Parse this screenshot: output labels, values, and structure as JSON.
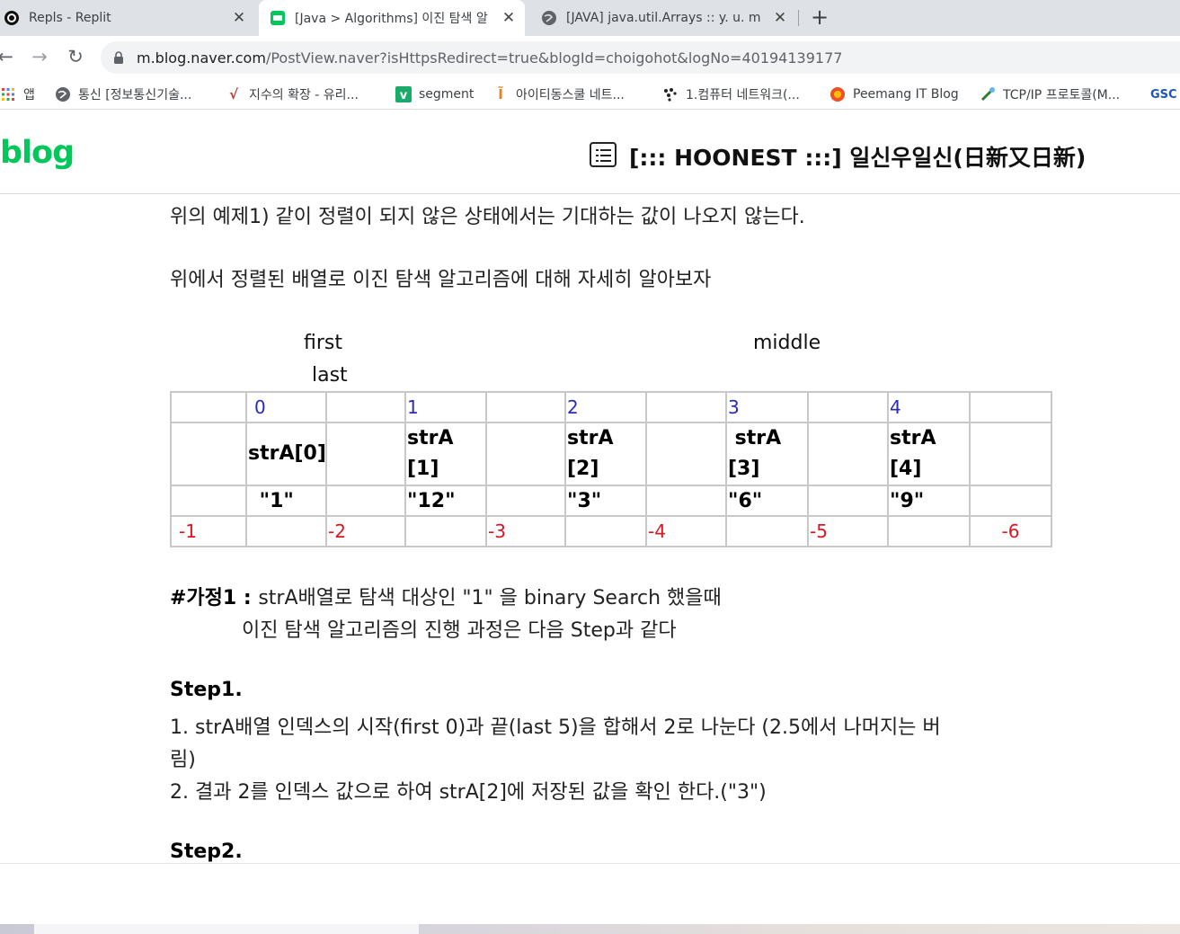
{
  "browser": {
    "tabs": [
      {
        "title": "Repls - Replit",
        "icon": "replit-icon"
      },
      {
        "title": "[Java > Algorithms] 이진 탐색 알",
        "icon": "naver-blog-icon"
      },
      {
        "title": "[JAVA] java.util.Arrays :: y. u. m",
        "icon": "globe-icon"
      }
    ],
    "new_tab": "+",
    "close_glyph": "✕",
    "url_host": "m.blog.naver.com",
    "url_path": "/PostView.naver?isHttpsRedirect=true&blogId=choigohot&logNo=40194139177",
    "bookmarks": [
      {
        "label": "앱",
        "icon": "apps-grid-icon"
      },
      {
        "label": "통신 [정보통신기술...",
        "icon": "globe-icon"
      },
      {
        "label": "지수의 확장 - 유리...",
        "icon": "sqrt-icon"
      },
      {
        "label": "segment",
        "icon": "v-icon"
      },
      {
        "label": "아이티동스쿨 네트...",
        "icon": "it-icon"
      },
      {
        "label": "1.컴퓨터 네트워크(...",
        "icon": "dots-icon"
      },
      {
        "label": "Peemang IT Blog",
        "icon": "peemang-icon"
      },
      {
        "label": "TCP/IP 프로토콜(M...",
        "icon": "tcp-icon"
      },
      {
        "label": "GSC",
        "icon": "gsc-icon"
      }
    ]
  },
  "blog": {
    "logo": "blog",
    "title": "[::: HOONEST :::] 일신우일신(日新又日新)"
  },
  "content": {
    "line1": "위의 예제1) 같이 정렬이 되지 않은 상태에서는 기대하는 값이 나오지 않는다.",
    "line2": "위에서 정렬된 배열로 이진 탐색 알고리즘에 대해 자세히 알아보자",
    "label_first": "first",
    "label_middle": "middle",
    "label_last": "last",
    "table": {
      "index_row": [
        "",
        "0",
        "",
        "1",
        "",
        "2",
        "",
        "3",
        "",
        "4",
        ""
      ],
      "name_row": [
        "",
        "strA[0]",
        "",
        "strA\n[1]",
        "",
        "strA\n[2]",
        "",
        " strA\n[3]",
        "",
        "strA\n[4]",
        ""
      ],
      "value_row": [
        "",
        " \"1\"",
        "",
        "\"12\"",
        "",
        "\"3\"",
        "",
        "\"6\"",
        "",
        "\"9\"",
        ""
      ],
      "neg_row": [
        "-1",
        "",
        "-2",
        "",
        "-3",
        "",
        "-4",
        "",
        "-5",
        "",
        "-6"
      ]
    },
    "hypothesis_label": "#가정1 : ",
    "hypothesis_text": "strA배열로 탐색 대상인 \"1\" 을 binary Search 했을때",
    "hypothesis_text2": "이진 탐색 알고리즘의 진행 과정은 다음 Step과 같다",
    "step1_title": "Step1.",
    "step1_line1": "1. strA배열 인덱스의 시작(first 0)과 끝(last 5)을 합해서 2로 나눈다 (2.5에서 나머지는 버",
    "step1_line1b": "림)",
    "step1_line2": "2. 결과 2를 인덱스 값으로 하여 strA[2]에 저장된 값을 확인 한다.(\"3\")",
    "step2_title": "Step2."
  },
  "colors": {
    "naver_green": "#03c75a",
    "index_blue": "#2a2ab8",
    "negative_red": "#e0141e"
  }
}
